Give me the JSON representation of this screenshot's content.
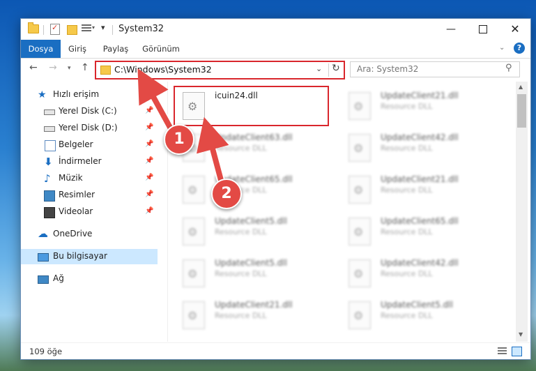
{
  "window": {
    "title": "System32"
  },
  "ribbon": {
    "tabs": [
      "Dosya",
      "Giriş",
      "Paylaş",
      "Görünüm"
    ],
    "help": "?"
  },
  "address": {
    "path": "C:\\Windows\\System32"
  },
  "search": {
    "placeholder": "Ara: System32"
  },
  "nav": {
    "items": [
      {
        "label": "Hızlı erişim"
      },
      {
        "label": "Yerel Disk (C:)"
      },
      {
        "label": "Yerel Disk (D:)"
      },
      {
        "label": "Belgeler"
      },
      {
        "label": "İndirmeler"
      },
      {
        "label": "Müzik"
      },
      {
        "label": "Resimler"
      },
      {
        "label": "Videolar"
      },
      {
        "label": "OneDrive"
      },
      {
        "label": "Bu bilgisayar"
      },
      {
        "label": "Ağ"
      }
    ]
  },
  "files": [
    {
      "name": "icuin24.dll",
      "type": ""
    },
    {
      "name": "UpdateClient21.dll",
      "type": "Resource DLL"
    },
    {
      "name": "UpdateClient63.dll",
      "type": "Resource DLL"
    },
    {
      "name": "UpdateClient42.dll",
      "type": "Resource DLL"
    },
    {
      "name": "UpdateClient65.dll",
      "type": "Resource DLL"
    },
    {
      "name": "UpdateClient21.dll",
      "type": "Resource DLL"
    },
    {
      "name": "UpdateClient5.dll",
      "type": "Resource DLL"
    },
    {
      "name": "UpdateClient65.dll",
      "type": "Resource DLL"
    },
    {
      "name": "UpdateClient5.dll",
      "type": "Resource DLL"
    },
    {
      "name": "UpdateClient42.dll",
      "type": "Resource DLL"
    },
    {
      "name": "UpdateClient21.dll",
      "type": "Resource DLL"
    },
    {
      "name": "UpdateClient5.dll",
      "type": "Resource DLL"
    }
  ],
  "status": {
    "count": "109 öğe"
  },
  "annotations": {
    "step1": "1",
    "step2": "2",
    "color": "#e34a45"
  }
}
